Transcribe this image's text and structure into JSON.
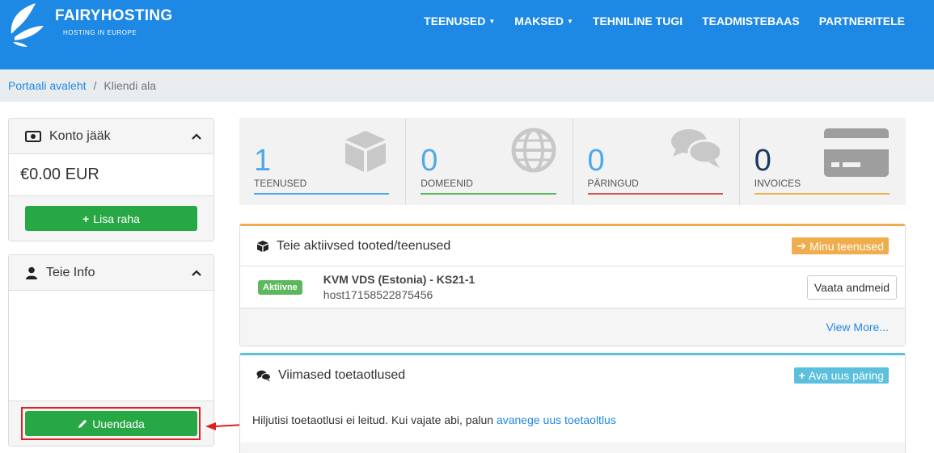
{
  "brand": {
    "name": "FAIRYHOSTING",
    "tagline": "HOSTING IN EUROPE"
  },
  "nav": [
    {
      "label": "TEENUSED",
      "has_dropdown": true
    },
    {
      "label": "MAKSED",
      "has_dropdown": true
    },
    {
      "label": "TEHNILINE TUGI",
      "has_dropdown": false
    },
    {
      "label": "TEADMISTEBAAS",
      "has_dropdown": false
    },
    {
      "label": "PARTNERITELE",
      "has_dropdown": false
    }
  ],
  "breadcrumb": {
    "home": "Portaali avaleht",
    "separator": "/",
    "current": "Kliendi ala"
  },
  "balance_panel": {
    "title": "Konto jääk",
    "amount": "€0.00 EUR",
    "button": "Lisa raha"
  },
  "info_panel": {
    "title": "Teie Info",
    "button": "Uuendada"
  },
  "stats": [
    {
      "value": "1",
      "label": "TEENUSED",
      "color": "#4fa8e8",
      "icon": "cube-icon"
    },
    {
      "value": "0",
      "label": "DOMEENID",
      "color": "#5cb85c",
      "icon": "globe-icon"
    },
    {
      "value": "0",
      "label": "PÄRINGUD",
      "color": "#d9534f",
      "icon": "comments-icon"
    },
    {
      "value": "0",
      "label": "INVOICES",
      "color": "#f0ad4e",
      "icon": "credit-card-icon"
    }
  ],
  "products_card": {
    "title": "Teie aktiivsed tooted/teenused",
    "header_button": "Minu teenused",
    "items": [
      {
        "status": "Aktiivne",
        "name": "KVM VDS (Estonia) - KS21-1",
        "host": "host17158522875456",
        "action": "Vaata andmeid"
      }
    ],
    "footer_link": "View More..."
  },
  "tickets_card": {
    "title": "Viimased toetaotlused",
    "header_button": "Ava uus päring",
    "message": "Hiljutisi toetaotlusi ei leitud. Kui vajate abi, palun",
    "message_link": "avanege uus toetaoltlus"
  },
  "colors": {
    "header": "#1e88e5",
    "green": "#28a745",
    "orange": "#f0ad4e",
    "info": "#5bc0de",
    "highlight": "#e02020"
  }
}
